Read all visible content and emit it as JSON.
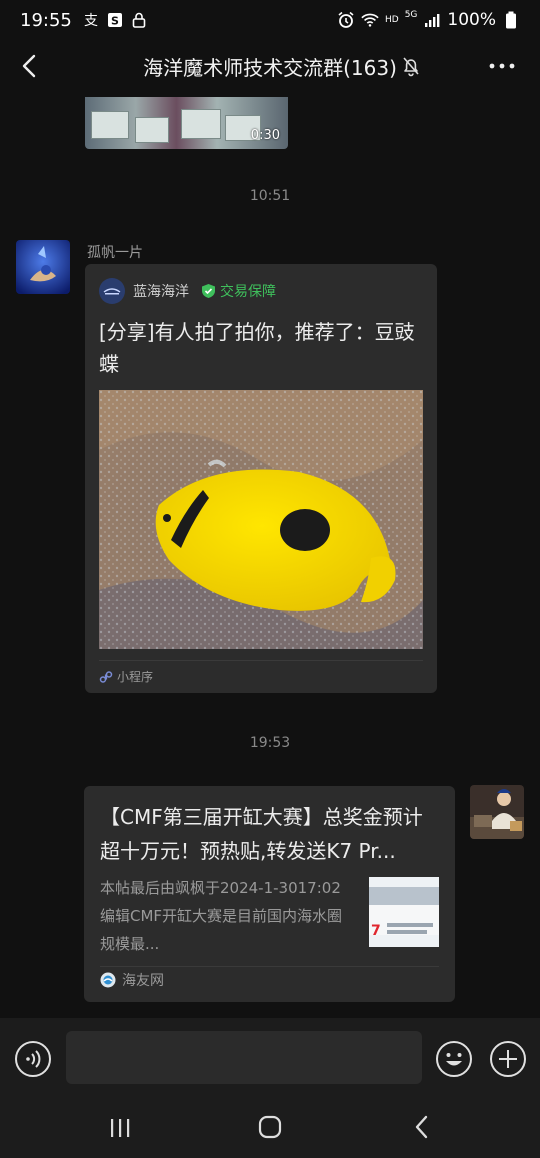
{
  "status_bar": {
    "time": "19:55",
    "battery": "100%",
    "network": "HD",
    "signal": "5G"
  },
  "header": {
    "title": "海洋魔术师技术交流群(163)"
  },
  "messages": {
    "video": {
      "duration": "0:30"
    },
    "timestamp_1": "10:51",
    "sender_name": "孤帆一片",
    "share_card": {
      "source_name": "蓝海海洋",
      "badge": "交易保障",
      "title": "[分享]有人拍了拍你，推荐了：豆豉蝶",
      "footer": "小程序"
    },
    "timestamp_2": "19:53",
    "link_card": {
      "title": "【CMF第三届开缸大赛】总奖金预计超十万元！预热贴,转发送K7 Pr...",
      "description": "本帖最后由飒枫于2024-1-3017:02编辑CMF开缸大赛是目前国内海水圈规模最...",
      "source": "海友网"
    }
  },
  "colors": {
    "background": "#111111",
    "card": "#2c2c2c",
    "badge_green": "#3fbf5c",
    "fish_yellow": "#f4d800"
  }
}
